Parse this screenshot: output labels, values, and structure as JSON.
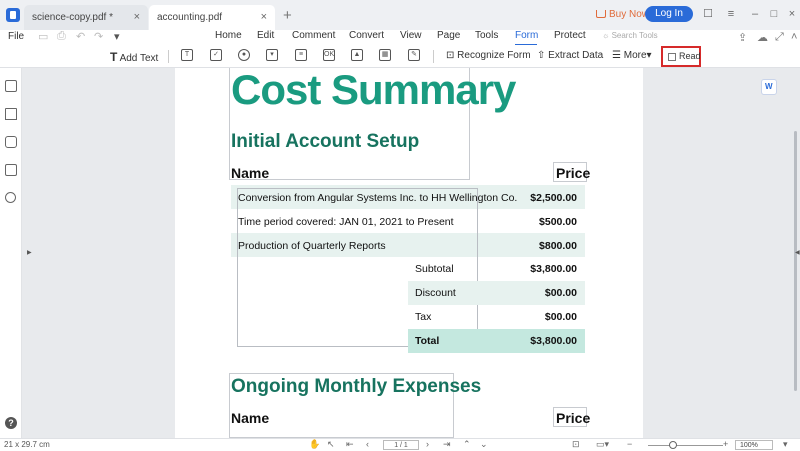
{
  "tabs": [
    {
      "label": "science-copy.pdf *"
    },
    {
      "label": "accounting.pdf"
    }
  ],
  "header": {
    "buy_now": "Buy Now",
    "login": "Log In"
  },
  "menu": {
    "file": "File",
    "items": [
      "Home",
      "Edit",
      "Comment",
      "Convert",
      "View",
      "Page",
      "Tools",
      "Form",
      "Protect"
    ],
    "active": "Form",
    "search_placeholder": "Search Tools"
  },
  "ribbon": {
    "add_text": "Add Text",
    "recognize_form": "Recognize Form",
    "extract_data": "Extract Data",
    "more": "More",
    "read": "Read"
  },
  "document": {
    "title": "Cost Summary",
    "section1": "Initial Account Setup",
    "col_name": "Name",
    "col_price": "Price",
    "rows": [
      {
        "desc": "Conversion from Angular Systems Inc. to HH Wellington Co.",
        "amount": "$2,500.00"
      },
      {
        "desc": "Time period covered: JAN 01, 2021 to Present",
        "amount": "$500.00"
      },
      {
        "desc": "Production of Quarterly Reports",
        "amount": "$800.00"
      }
    ],
    "summary": [
      {
        "label": "Subtotal",
        "amount": "$3,800.00"
      },
      {
        "label": "Discount",
        "amount": "$00.00"
      },
      {
        "label": "Tax",
        "amount": "$00.00"
      },
      {
        "label": "Total",
        "amount": "$3,800.00"
      }
    ],
    "section2": "Ongoing Monthly Expenses",
    "col_name2": "Name",
    "col_price2": "Price"
  },
  "status": {
    "page_size": "21 x 29.7 cm",
    "page_indicator": "1 / 1",
    "zoom": "100%"
  },
  "colors": {
    "accent": "#2a6bd8",
    "title_green": "#1a9b80",
    "heading_green": "#17735f",
    "row_shade": "#e7f2ef",
    "total_shade": "#c4e8df",
    "highlight_red": "#d62a2a"
  }
}
